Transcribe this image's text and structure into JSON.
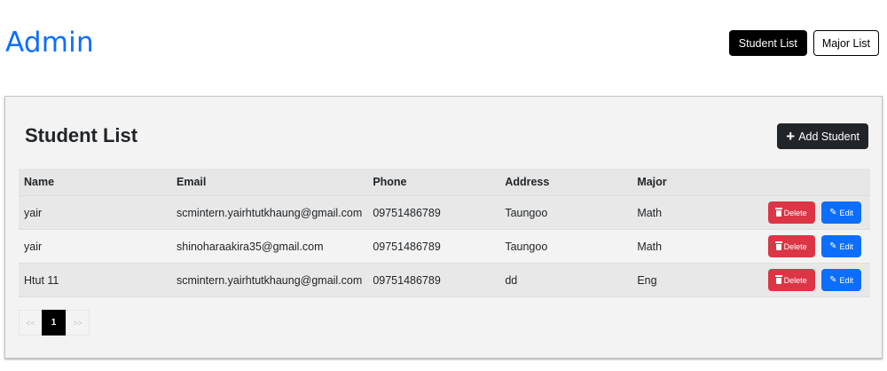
{
  "header": {
    "brand": "Admin",
    "nav": [
      {
        "label": "Student List"
      },
      {
        "label": "Major List"
      }
    ]
  },
  "card": {
    "title": "Student List",
    "add_button": "Add Student"
  },
  "table": {
    "columns": [
      "Name",
      "Email",
      "Phone",
      "Address",
      "Major"
    ],
    "rows": [
      {
        "name": "yair",
        "email": "scmintern.yairhtutkhaung@gmail.com",
        "phone": "09751486789",
        "address": "Taungoo",
        "major": "Math"
      },
      {
        "name": "yair",
        "email": "shinoharaakira35@gmail.com",
        "phone": "09751486789",
        "address": "Taungoo",
        "major": "Math"
      },
      {
        "name": "Htut 11",
        "email": "scmintern.yairhtutkhaung@gmail.com",
        "phone": "09751486789",
        "address": "dd",
        "major": "Eng"
      }
    ],
    "delete_label": "Delete",
    "edit_label": "Edit"
  },
  "pagination": {
    "prev": "<<",
    "current": "1",
    "next": ">>"
  },
  "icons": {
    "add": "plus-icon",
    "delete": "trash-icon",
    "edit": "edit-icon"
  },
  "colors": {
    "brand": "#0d6efd",
    "danger": "#dc3545",
    "primary": "#0d6efd",
    "dark": "#212529"
  }
}
